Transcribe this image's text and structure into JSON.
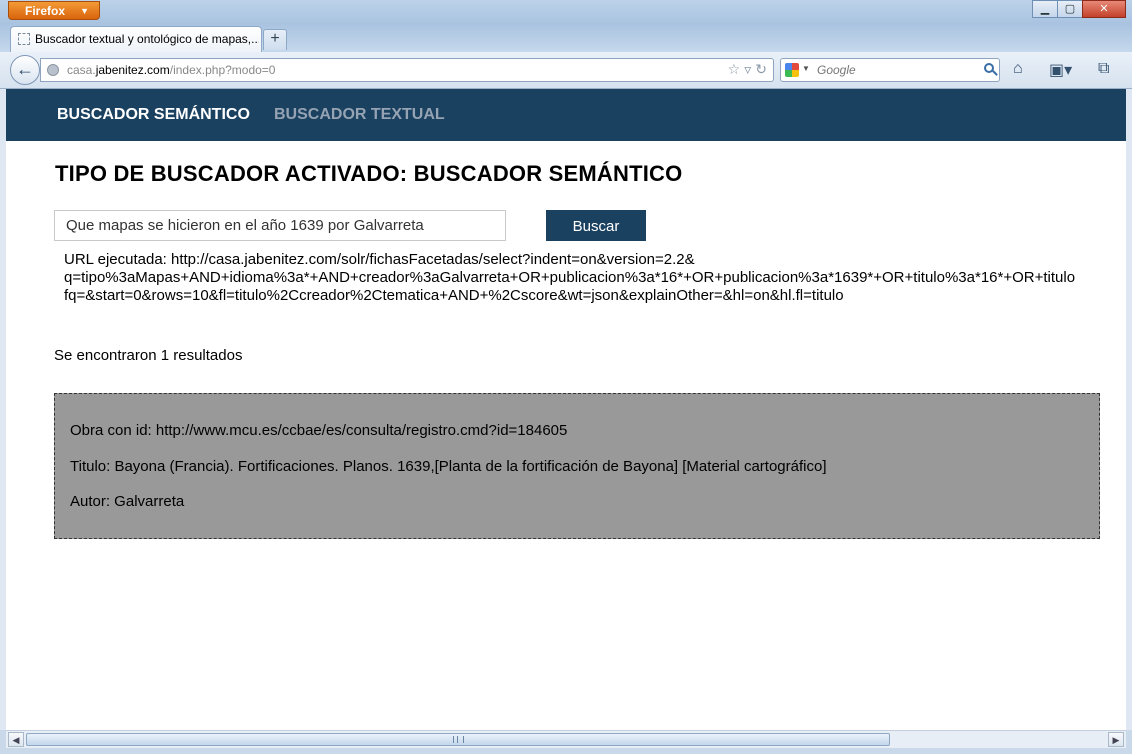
{
  "browser": {
    "menu_button_label": "Firefox",
    "tab": {
      "title": "Buscador textual y ontológico de mapas,..."
    },
    "address": {
      "prefix": "casa.",
      "domain": "jabenitez.com",
      "path": "/index.php?modo=0"
    },
    "search": {
      "placeholder": "Google"
    },
    "icons": [
      "back-icon",
      "globe-icon",
      "star-icon",
      "dropdown-icon",
      "reload-icon",
      "google-icon",
      "magnifier-icon",
      "home-icon",
      "bookmarks-icon",
      "addons-icon"
    ]
  },
  "site_nav": {
    "semantic_label": "BUSCADOR SEMÁNTICO",
    "textual_label": "BUSCADOR TEXTUAL",
    "active_color": "#ffffff",
    "inactive_color": "#95a3b2",
    "background_color": "#1b4161"
  },
  "main": {
    "title": "TIPO DE BUSCADOR ACTIVADO: BUSCADOR SEMÁNTICO",
    "query_value": "Que mapas se hicieron en el año 1639 por Galvarreta",
    "search_button_label": "Buscar",
    "executed_url_lines": [
      "URL ejecutada: http://casa.jabenitez.com/solr/fichasFacetadas/select?indent=on&version=2.2&",
      "q=tipo%3aMapas+AND+idioma%3a*+AND+creador%3aGalvarreta+OR+publicacion%3a*16*+OR+publicacion%3a*1639*+OR+titulo%3a*16*+OR+titulo",
      "fq=&start=0&rows=10&fl=titulo%2Ccreador%2Ctematica+AND+%2Cscore&wt=json&explainOther=&hl=on&hl.fl=titulo"
    ],
    "results_count_text": "Se encontraron 1 resultados",
    "results": [
      {
        "id_line": "Obra con id: http://www.mcu.es/ccbae/es/consulta/registro.cmd?id=184605",
        "title_line": "Titulo: Bayona (Francia). Fortificaciones. Planos. 1639,[Planta de la fortificación de Bayona] [Material cartográfico]",
        "author_line": "Autor: Galvarreta"
      }
    ]
  }
}
